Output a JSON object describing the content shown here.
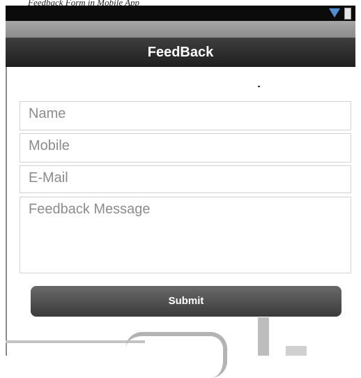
{
  "caption": "Feedback Form in Mobile App",
  "statusbar": {
    "wifi_icon": "wifi-icon",
    "battery_icon": "battery-icon"
  },
  "appbar": {
    "title": "FeedBack"
  },
  "form": {
    "name_placeholder": "Name",
    "mobile_placeholder": "Mobile",
    "email_placeholder": "E-Mail",
    "message_placeholder": "Feedback Message",
    "submit_label": "Submit"
  }
}
